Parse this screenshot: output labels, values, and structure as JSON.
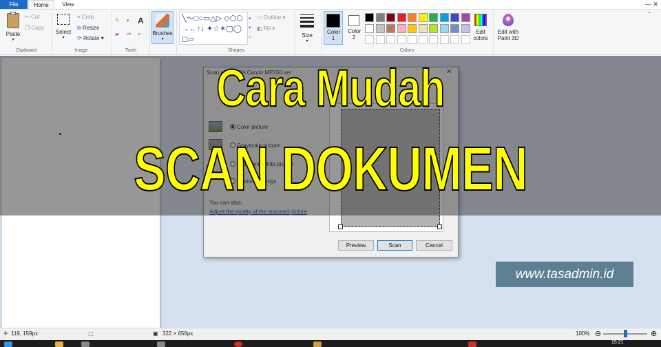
{
  "tabs": {
    "file": "File",
    "home": "Home",
    "view": "View"
  },
  "window_controls": "—  ✕",
  "ribbon": {
    "clipboard": {
      "paste": "Paste",
      "cut": "Cut",
      "copy": "Copy",
      "group": "Clipboard"
    },
    "image": {
      "select": "Select",
      "crop": "Crop",
      "resize": "Resize",
      "rotate": "Rotate ▾",
      "group": "Image"
    },
    "tools": {
      "group": "Tools",
      "text_tool": "A"
    },
    "brushes": {
      "label": "Brushes"
    },
    "shapes": {
      "group": "Shapes",
      "outline": "Outline ▾",
      "fill": "Fill ▾",
      "glyphs": "╲〜□○▭△▷ ◇⬠⬡→←↑↓ ✦☆✶▢◯◻▱"
    },
    "size": {
      "label": "Size"
    },
    "color1": {
      "label": "Color 1",
      "value": "#000000"
    },
    "color2": {
      "label": "Color 2",
      "value": "#ffffff"
    },
    "colors": {
      "group": "Colors",
      "row1": [
        "#000000",
        "#7f7f7f",
        "#880015",
        "#ed1c24",
        "#ff7f27",
        "#fff200",
        "#22b14c",
        "#00a2e8",
        "#3f48cc",
        "#a349a4"
      ],
      "row2": [
        "#ffffff",
        "#c3c3c3",
        "#b97a57",
        "#ffaec9",
        "#ffc90e",
        "#efe4b0",
        "#b5e61d",
        "#99d9ea",
        "#7092be",
        "#c8bfe7"
      ],
      "row3": [
        "#ffffff",
        "#ffffff",
        "#ffffff",
        "#ffffff",
        "#ffffff",
        "#ffffff",
        "#ffffff",
        "#ffffff",
        "#ffffff",
        "#ffffff"
      ]
    },
    "edit_colors": "Edit colors",
    "edit_paint3d": "Edit with Paint 3D"
  },
  "dialog": {
    "title": "Scan using WIA Canon MP250 ser",
    "close": "✕",
    "option_color": "Color picture",
    "option_gray": "Grayscale picture",
    "option_bw": "Black and white picture",
    "option_custom": "Custom settings",
    "you_can_also": "You can also:",
    "adjust_link": "Adjust the quality of the scanned picture",
    "preview": "Preview",
    "scan": "Scan",
    "cancel": "Cancel"
  },
  "overlay": {
    "line1": "Cara Mudah",
    "line2": "SCAN DOKUMEN",
    "watermark": "www.tasadmin.id"
  },
  "status": {
    "cursor": "119, 159px",
    "size": "322 × 658px",
    "zoom": "100%",
    "zoom_level": 1.0
  },
  "clock": "15:21"
}
